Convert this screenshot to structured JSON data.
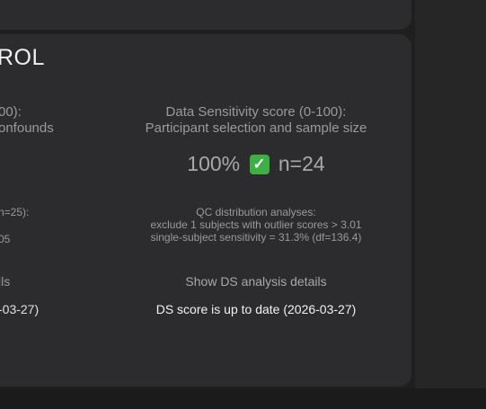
{
  "panel": {
    "title_fragment": "ROL"
  },
  "left_column": {
    "score_title_line1": "00):",
    "score_title_line2": "onfounds",
    "qc_fragment_line1": "n=25):",
    "qc_fragment_line2": "05",
    "details_fragment": "ils",
    "status_fragment": "-03-27)"
  },
  "ds": {
    "title_line1": "Data Sensitivity score (0-100):",
    "title_line2": "Participant selection and sample size",
    "score": "100%",
    "check_icon": "check-mark-button-emoji",
    "check_glyph": "✓",
    "n": "n=24",
    "qc_line1": "QC distribution analyses:",
    "qc_line2": "exclude 1 subjects with outlier scores > 3.01",
    "qc_line3": "single-subject sensitivity = 31.3% (df=136.4)",
    "details_label": "Show DS analysis details",
    "status": "DS score is up to date (2026-03-27)",
    "colors": {
      "check_bg": "#3cb043",
      "card_bg": "#2c2c2e",
      "page_bg": "#1f1f1f"
    }
  }
}
